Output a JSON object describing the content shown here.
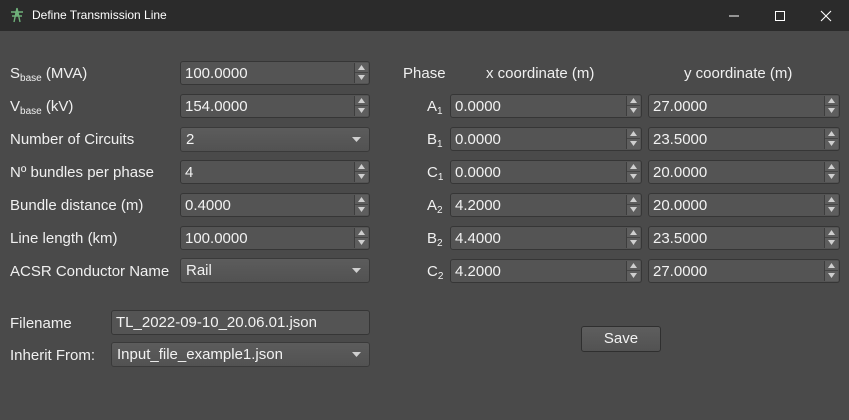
{
  "window": {
    "title": "Define Transmission Line",
    "controls": [
      "minimize",
      "maximize",
      "close"
    ]
  },
  "parameters": {
    "sbase": {
      "label_main": "S",
      "label_sub": "base",
      "label_rest": " (MVA)",
      "value": "100.0000"
    },
    "vbase": {
      "label_main": "V",
      "label_sub": "base",
      "label_rest": " (kV)",
      "value": "154.0000"
    },
    "circuits": {
      "label": "Number of Circuits",
      "value": "2"
    },
    "bundles": {
      "label": "Nº bundles per phase",
      "value": "4"
    },
    "bundle_distance": {
      "label": "Bundle distance (m)",
      "value": "0.4000"
    },
    "line_length": {
      "label": "Line length (km)",
      "value": "100.0000"
    },
    "conductor": {
      "label": "ACSR Conductor Name",
      "value": "Rail"
    }
  },
  "coordinates": {
    "headers": {
      "phase": "Phase",
      "x": "x coordinate (m)",
      "y": "y coordinate (m)"
    },
    "rows": [
      {
        "phase": "A",
        "sub": "1",
        "x": "0.0000",
        "y": "27.0000"
      },
      {
        "phase": "B",
        "sub": "1",
        "x": "0.0000",
        "y": "23.5000"
      },
      {
        "phase": "C",
        "sub": "1",
        "x": "0.0000",
        "y": "20.0000"
      },
      {
        "phase": "A",
        "sub": "2",
        "x": "4.2000",
        "y": "20.0000"
      },
      {
        "phase": "B",
        "sub": "2",
        "x": "4.4000",
        "y": "23.5000"
      },
      {
        "phase": "C",
        "sub": "2",
        "x": "4.2000",
        "y": "27.0000"
      }
    ]
  },
  "file": {
    "filename_label": "Filename",
    "filename_value": "TL_2022-09-10_20.06.01.json",
    "inherit_label": "Inherit From:",
    "inherit_value": "Input_file_example1.json"
  },
  "actions": {
    "save_label": "Save"
  },
  "colors": {
    "background": "#4a4a4a",
    "titlebar": "#2b2b2b",
    "field": "#545454",
    "text": "#f2f2f2"
  }
}
